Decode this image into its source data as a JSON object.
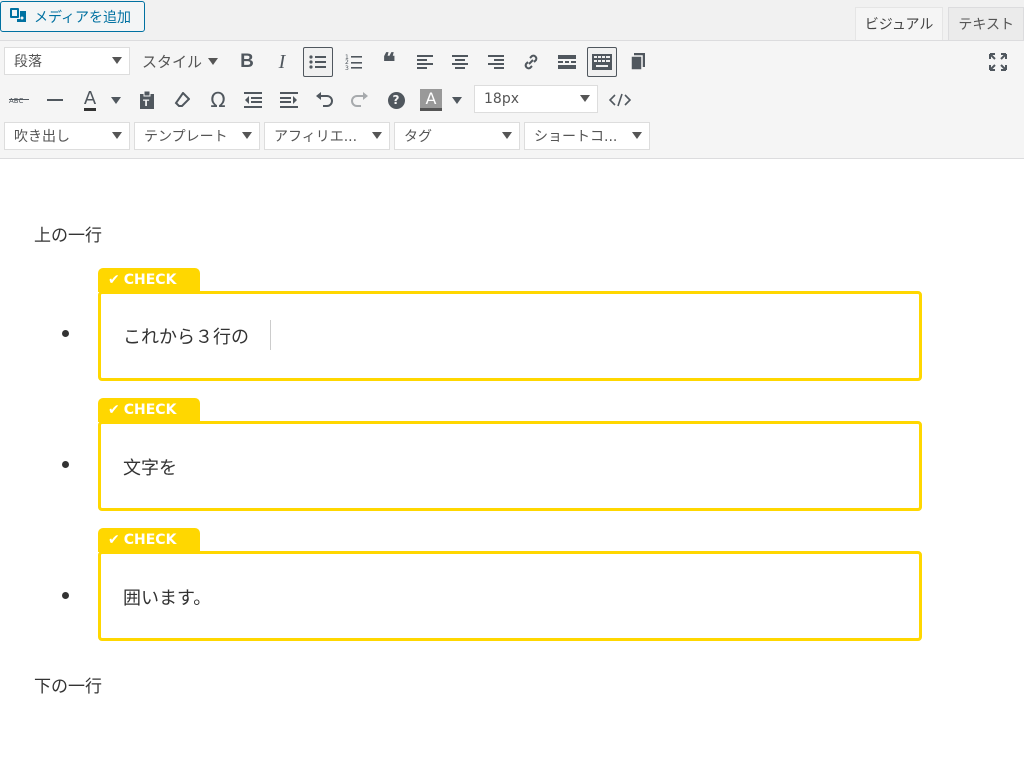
{
  "header": {
    "media_button": "メディアを追加",
    "tabs": [
      {
        "label": "ビジュアル",
        "active": true
      },
      {
        "label": "テキスト",
        "active": false
      }
    ]
  },
  "toolbar": {
    "format_select": "段落",
    "style_select": "スタイル",
    "font_size": "18px",
    "selects_row3": [
      "吹き出し",
      "テンプレート",
      "アフィリエ...",
      "タグ",
      "ショートコ..."
    ],
    "icons_row1": [
      "bold-icon",
      "italic-icon",
      "bullet-list-icon",
      "numbered-list-icon",
      "blockquote-icon",
      "align-left-icon",
      "align-center-icon",
      "align-right-icon",
      "link-icon",
      "read-more-icon",
      "toolbar-toggle-icon",
      "copy-icon",
      "fullscreen-icon"
    ],
    "icons_row2": [
      "strikethrough-icon",
      "horizontal-line-icon",
      "text-color-icon",
      "paste-text-icon",
      "clear-format-icon",
      "special-char-icon",
      "outdent-icon",
      "indent-icon",
      "undo-icon",
      "redo-icon",
      "help-icon",
      "background-color-icon",
      "code-icon"
    ],
    "bold_label": "B",
    "italic_label": "I",
    "text_color_label": "A",
    "bg_color_label": "A",
    "omega_label": "Ω",
    "help_label": "?"
  },
  "editor": {
    "top_line": "上の一行",
    "bottom_line": "下の一行",
    "check_label": "CHECK",
    "items": [
      "これから３行の",
      "文字を",
      "囲います。"
    ],
    "accent_color": "#ffd700"
  }
}
